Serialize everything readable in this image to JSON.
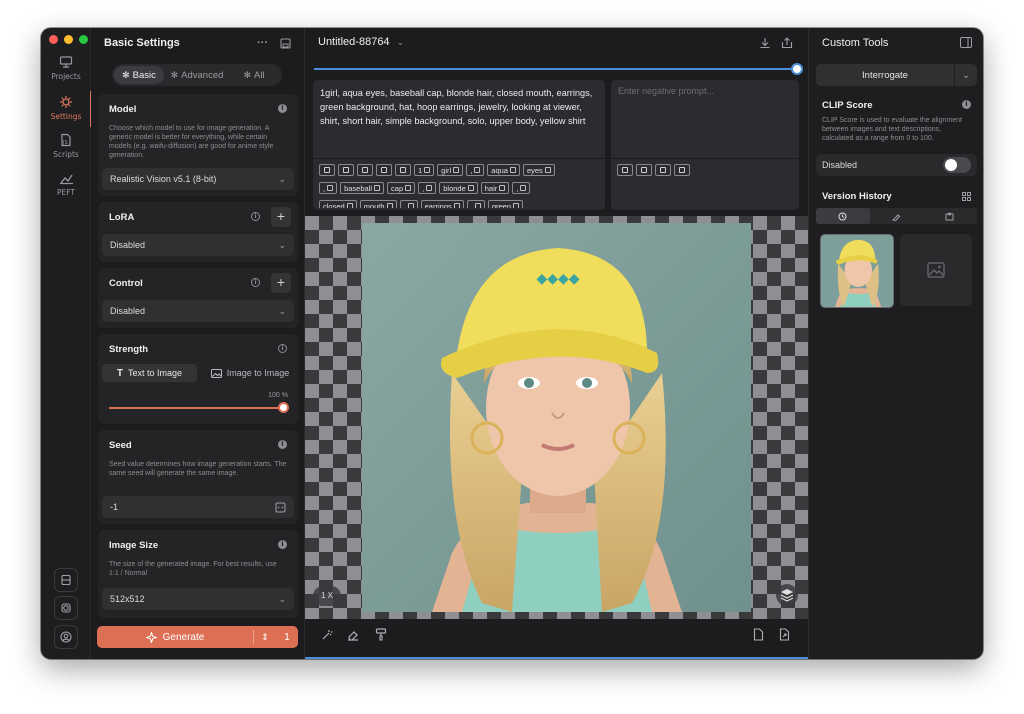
{
  "rail": {
    "items": [
      {
        "label": "Projects",
        "icon": "projects-icon"
      },
      {
        "label": "Settings",
        "icon": "settings-icon"
      },
      {
        "label": "Scripts",
        "icon": "scripts-icon"
      },
      {
        "label": "PEFT",
        "icon": "peft-icon"
      }
    ],
    "bottom_icons": [
      "sd-card-icon",
      "gear-icon",
      "account-icon"
    ]
  },
  "settings": {
    "title": "Basic Settings",
    "tabs": [
      "Basic",
      "Advanced",
      "All"
    ],
    "model": {
      "title": "Model",
      "desc": "Choose which model to use for image generation. A generic model is better for everything, while certain models (e.g. waifu-diffusion) are good for anime style generation.",
      "value": "Realistic Vision v5.1 (8-bit)"
    },
    "lora": {
      "title": "LoRA",
      "value": "Disabled"
    },
    "control": {
      "title": "Control",
      "value": "Disabled"
    },
    "strength": {
      "title": "Strength",
      "mode_text": "Text to Image",
      "mode_image": "Image to Image",
      "value_label": "100 %",
      "value": 100
    },
    "seed": {
      "title": "Seed",
      "desc": "Seed value determines how image generation starts. The same seed will generate the same image.",
      "value": "-1"
    },
    "image_size": {
      "title": "Image Size",
      "desc": "The size of the generated image. For best results, use 1:1 / Normal",
      "value": "512x512"
    },
    "generate_label": "Generate",
    "generate_count": "1"
  },
  "center": {
    "doc_title": "Untitled-88764",
    "prompt": "1girl, aqua eyes, baseball cap, blonde hair, closed mouth, earrings, green background, hat, hoop earrings, jewelry, looking at viewer, shirt, short hair, simple background, solo, upper body, yellow shirt",
    "negative_placeholder": "Enter negative prompt...",
    "tokens_row1": [
      "1",
      "girl",
      ",",
      "aqua",
      "eyes"
    ],
    "tokens_row2": [
      ",",
      "baseball",
      "cap",
      ",",
      "blonde",
      "hair",
      ","
    ],
    "tokens_row3": [
      "closed",
      "mouth",
      ",",
      "earrings",
      ",",
      "green"
    ],
    "zoom": "1 X"
  },
  "right": {
    "title": "Custom Tools",
    "interrogate_label": "Interrogate",
    "clip": {
      "title": "CLIP Score",
      "desc": "CLIP Score is used to evaluate the alignment between images and text descriptions, calculated as a range from 0 to 100.",
      "toggle_label": "Disabled"
    },
    "version_history_title": "Version History"
  },
  "colors": {
    "accent": "#dd6f55",
    "blue": "#4a8ed6"
  }
}
